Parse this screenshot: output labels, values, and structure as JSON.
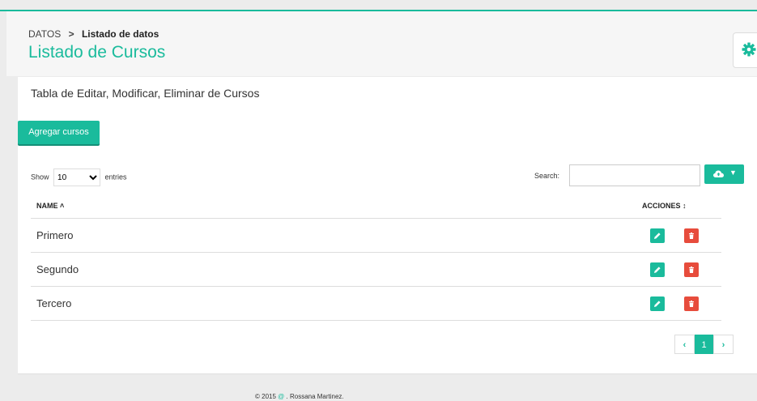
{
  "breadcrumb": {
    "root": "DATOS",
    "separator": ">",
    "current": "Listado de datos"
  },
  "page_title": "Listado de Cursos",
  "panel": {
    "title": "Tabla de Editar, Modificar, Eliminar de Cursos",
    "add_button": "Agregar cursos"
  },
  "table_controls": {
    "show_label": "Show",
    "entries_value": "10",
    "entries_label": "entries",
    "search_label": "Search:",
    "search_value": ""
  },
  "table": {
    "columns": [
      "NAME ˄",
      "ACCIONES ↕"
    ],
    "rows": [
      {
        "name": "Primero"
      },
      {
        "name": "Segundo"
      },
      {
        "name": "Tercero"
      }
    ]
  },
  "pagination": {
    "prev": "‹",
    "current": "1",
    "next": "›"
  },
  "footer": {
    "prefix": "© 2015",
    "at": "@",
    "author": ". Rossana Martinez."
  },
  "colors": {
    "accent": "#1abb9c",
    "danger": "#e74c3c"
  },
  "icons": [
    "gear-icon",
    "cloud-icon",
    "edit-icon",
    "delete-icon"
  ]
}
